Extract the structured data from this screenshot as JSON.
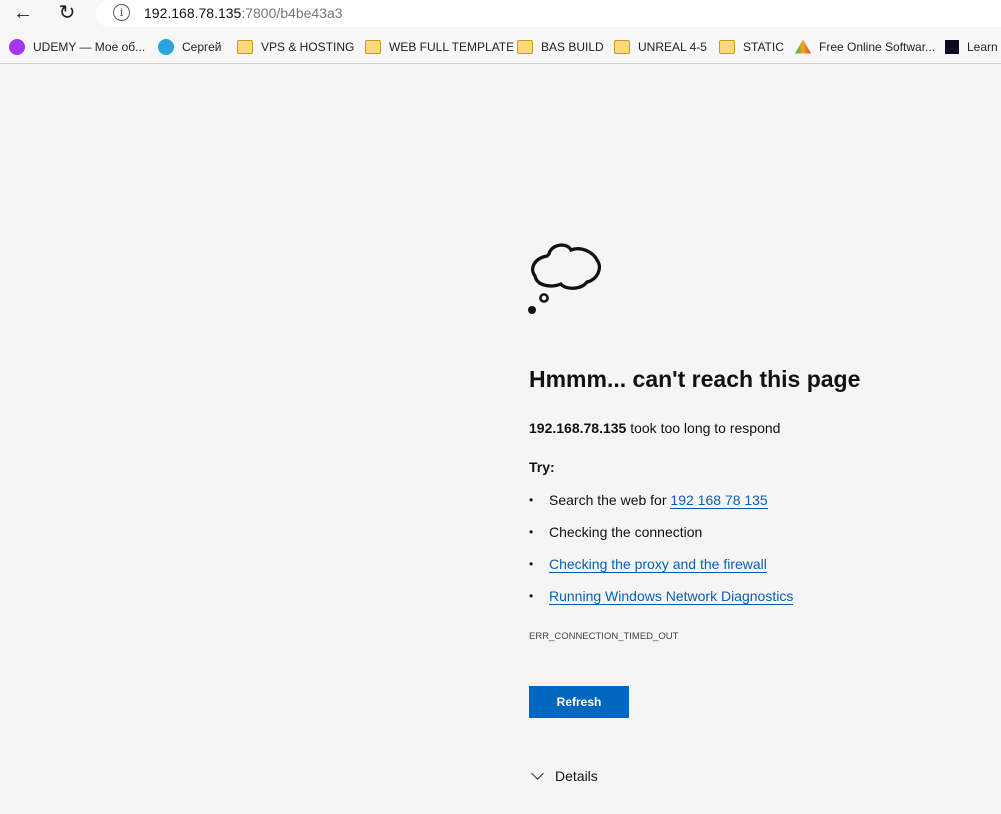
{
  "browser": {
    "url_host": "192.168.78.135",
    "url_rest": ":7800/b4be43a3",
    "back_icon": "arrow-left",
    "refresh_icon": "reload",
    "info_icon": "info"
  },
  "bookmarks": [
    {
      "label": "UDEMY — Мое об...",
      "icon": "udemy",
      "color": "#a435f0"
    },
    {
      "label": "Сергей",
      "icon": "telegram",
      "color": "#2aa3df"
    },
    {
      "label": "VPS & HOSTING",
      "icon": "folder"
    },
    {
      "label": "WEB FULL TEMPLATE",
      "icon": "folder"
    },
    {
      "label": "BAS BUILD",
      "icon": "folder"
    },
    {
      "label": "UNREAL 4-5",
      "icon": "folder"
    },
    {
      "label": "STATIC",
      "icon": "folder"
    },
    {
      "label": "Free Online Softwar...",
      "icon": "triangle-logo"
    },
    {
      "label": "Learn",
      "icon": "freecodecamp"
    }
  ],
  "error": {
    "title": "Hmmm... can't reach this page",
    "host": "192.168.78.135",
    "message": " took too long to respond",
    "try_label": "Try:",
    "suggestions": {
      "search_prefix": "Search the web for ",
      "search_link": "192 168 78 135",
      "connection": "Checking the connection",
      "proxy": "Checking the proxy and the firewall",
      "diagnostics": "Running Windows Network Diagnostics"
    },
    "code": "ERR_CONNECTION_TIMED_OUT",
    "refresh": "Refresh",
    "details": "Details"
  },
  "colors": {
    "accent": "#0067c0",
    "link": "#0a5fb4"
  }
}
